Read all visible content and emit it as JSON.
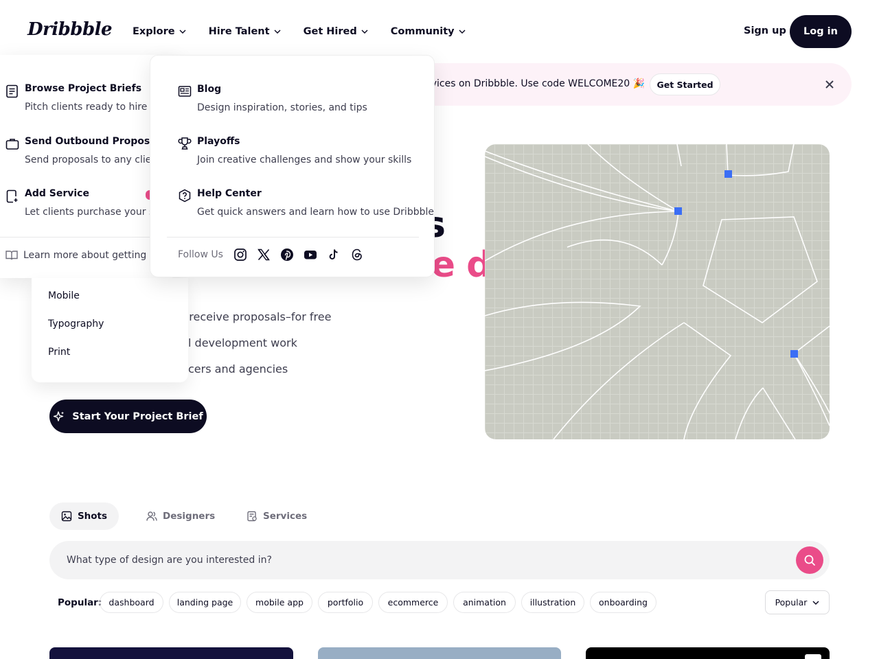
{
  "header": {
    "logo": "Dribbble",
    "nav": [
      "Explore",
      "Hire Talent",
      "Get Hired",
      "Community"
    ],
    "sign_up": "Sign up",
    "log_in": "Log in"
  },
  "promo": {
    "text": "rvices on Dribbble. Use code WELCOME20 🎉",
    "button": "Get Started"
  },
  "hero": {
    "heading_visible_fragment_1": "s",
    "heading_visible_fragment_2": "mobile design",
    "lines": [
      "d receive proposals–for free",
      "l development work",
      "cers and agencies"
    ],
    "cta": "Start Your Project Brief"
  },
  "get_hired_menu": {
    "items": [
      {
        "title": "Browse Project Briefs",
        "desc": "Pitch clients ready to hire now"
      },
      {
        "title": "Send Outbound Proposal",
        "desc": "Send proposals to any client"
      },
      {
        "title": "Add Service",
        "desc": "Let clients purchase your services"
      }
    ],
    "learn_more": "Learn more about getting hired"
  },
  "explore_menu": {
    "items": [
      "Mobile",
      "Typography",
      "Print"
    ]
  },
  "community_menu": {
    "items": [
      {
        "title": "Blog",
        "desc": "Design inspiration, stories, and tips"
      },
      {
        "title": "Playoffs",
        "desc": "Join creative challenges and show your skills"
      },
      {
        "title": "Help Center",
        "desc": "Get quick answers and learn how to use Dribbble"
      }
    ],
    "follow_us": "Follow Us",
    "social_icons": [
      "instagram-icon",
      "x-icon",
      "pinterest-icon",
      "youtube-icon",
      "tiktok-icon",
      "threads-icon"
    ]
  },
  "tabs": [
    "Shots",
    "Designers",
    "Services"
  ],
  "search": {
    "placeholder": "What type of design are you interested in?"
  },
  "popular": {
    "label": "Popular:",
    "tags": [
      "dashboard",
      "landing page",
      "mobile app",
      "portfolio",
      "ecommerce",
      "animation",
      "illustration",
      "onboarding"
    ]
  },
  "sort": "Popular",
  "colors": {
    "brand_pink": "#ea4c89",
    "ink": "#0d0c22",
    "promo_bg": "#fdf2f8",
    "selection_blue": "#3b6ef5"
  }
}
